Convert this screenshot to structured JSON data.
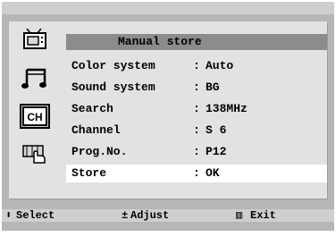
{
  "menu": {
    "title": "Manual store",
    "rows": [
      {
        "label": "Color system",
        "value": "Auto"
      },
      {
        "label": "Sound system",
        "value": "BG"
      },
      {
        "label": "Search",
        "value": "138MHz"
      },
      {
        "label": "Channel",
        "value": "S 6"
      },
      {
        "label": "Prog.No.",
        "value": "P12"
      },
      {
        "label": "Store",
        "value": "OK"
      }
    ],
    "selected_row": "Store"
  },
  "sidebar": {
    "icons": [
      {
        "name": "picture-icon"
      },
      {
        "name": "sound-icon"
      },
      {
        "name": "channel-icon",
        "text": "CH",
        "selected": true
      },
      {
        "name": "setup-icon"
      }
    ]
  },
  "footer": {
    "select_symbol": "⬍",
    "select_label": "Select",
    "adjust_symbol": "±",
    "adjust_label": "Adjust",
    "exit_symbol": "▥",
    "exit_label": "Exit"
  },
  "colors": {
    "screen_bg": "#b6b6b6",
    "panel_bg": "#e2e2e2",
    "title_bar": "#8c8c8c",
    "highlight": "#ffffff"
  }
}
